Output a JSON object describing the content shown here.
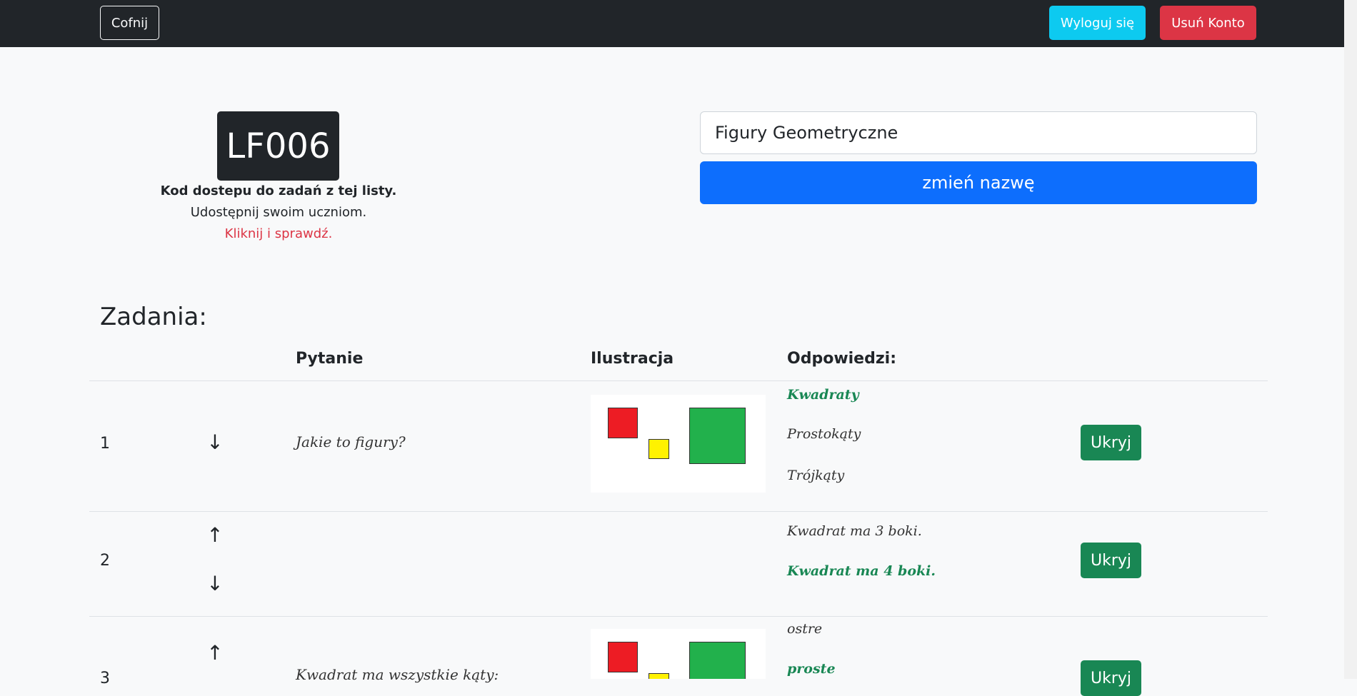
{
  "nav": {
    "back_label": "Cofnij",
    "logout_label": "Wyloguj się",
    "delete_label": "Usuń Konto"
  },
  "access": {
    "code": "LF006",
    "label_bold": "Kod dostepu do zadań z tej listy.",
    "label_share": "Udostępnij swoim uczniom.",
    "label_link": "Kliknij i sprawdź."
  },
  "list_name": {
    "value": "Figury Geometryczne",
    "rename_label": "zmień nazwę"
  },
  "tasks": {
    "heading": "Zadania:",
    "columns": [
      "Pytanie",
      "Ilustracja",
      "Odpowiedzi:"
    ],
    "rows": [
      {
        "number": "1",
        "question": "Jakie to figury?",
        "answers": [
          {
            "text": "Kwadraty",
            "correct": true
          },
          {
            "text": "Prostokąty",
            "correct": false
          },
          {
            "text": "Trójkąty",
            "correct": false
          }
        ],
        "hide_label": "Ukryj"
      },
      {
        "number": "2",
        "question": "",
        "answers": [
          {
            "text": "Kwadrat ma 3 boki.",
            "correct": false
          },
          {
            "text": "Kwadrat ma 4 boki.",
            "correct": true
          }
        ],
        "hide_label": "Ukryj"
      },
      {
        "number": "3",
        "question": "Kwadrat ma wszystkie kąty:",
        "answers": [
          {
            "text": "ostre",
            "correct": false
          },
          {
            "text": "proste",
            "correct": true
          }
        ],
        "hide_label": "Ukryj"
      }
    ]
  },
  "icons": {
    "up": "arrow-up-icon",
    "down": "arrow-down-icon"
  },
  "colors": {
    "navbar": "#212529",
    "logout": "#0dcaf0",
    "delete": "#dc3545",
    "primary": "#0d6efd",
    "success": "#198754",
    "shape_red": "#ed1c24",
    "shape_yellow": "#fff200",
    "shape_green": "#22b14c"
  }
}
